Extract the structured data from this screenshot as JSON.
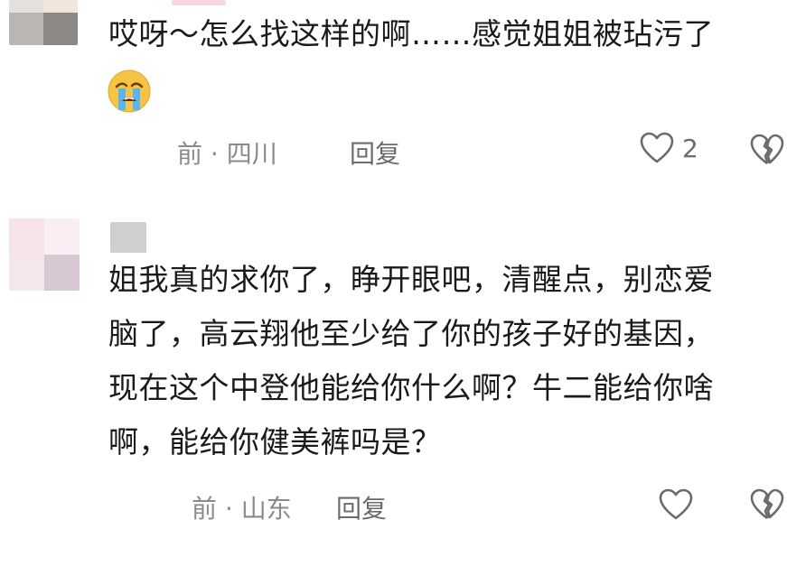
{
  "comments": [
    {
      "text_lines": [
        "哎呀～怎么找这样的啊……感觉姐姐被玷污了"
      ],
      "emoji": "loudly-crying-face",
      "meta": "前 · 四川",
      "reply_label": "回复",
      "like_count": "2"
    },
    {
      "text_lines": [
        "姐我真的求你了，睁开眼吧，清醒点，别恋爱",
        "脑了，高云翔他至少给了你的孩子好的基因，",
        "现在这个中登他能给你什么啊？牛二能给你啥",
        "啊，能给你健美裤吗是？"
      ],
      "meta": "前 · 山东",
      "reply_label": "回复",
      "like_count": ""
    }
  ],
  "colors": {
    "text": "#1a1a1a",
    "meta": "#8a8a8a",
    "icon": "#6b6b6b"
  }
}
